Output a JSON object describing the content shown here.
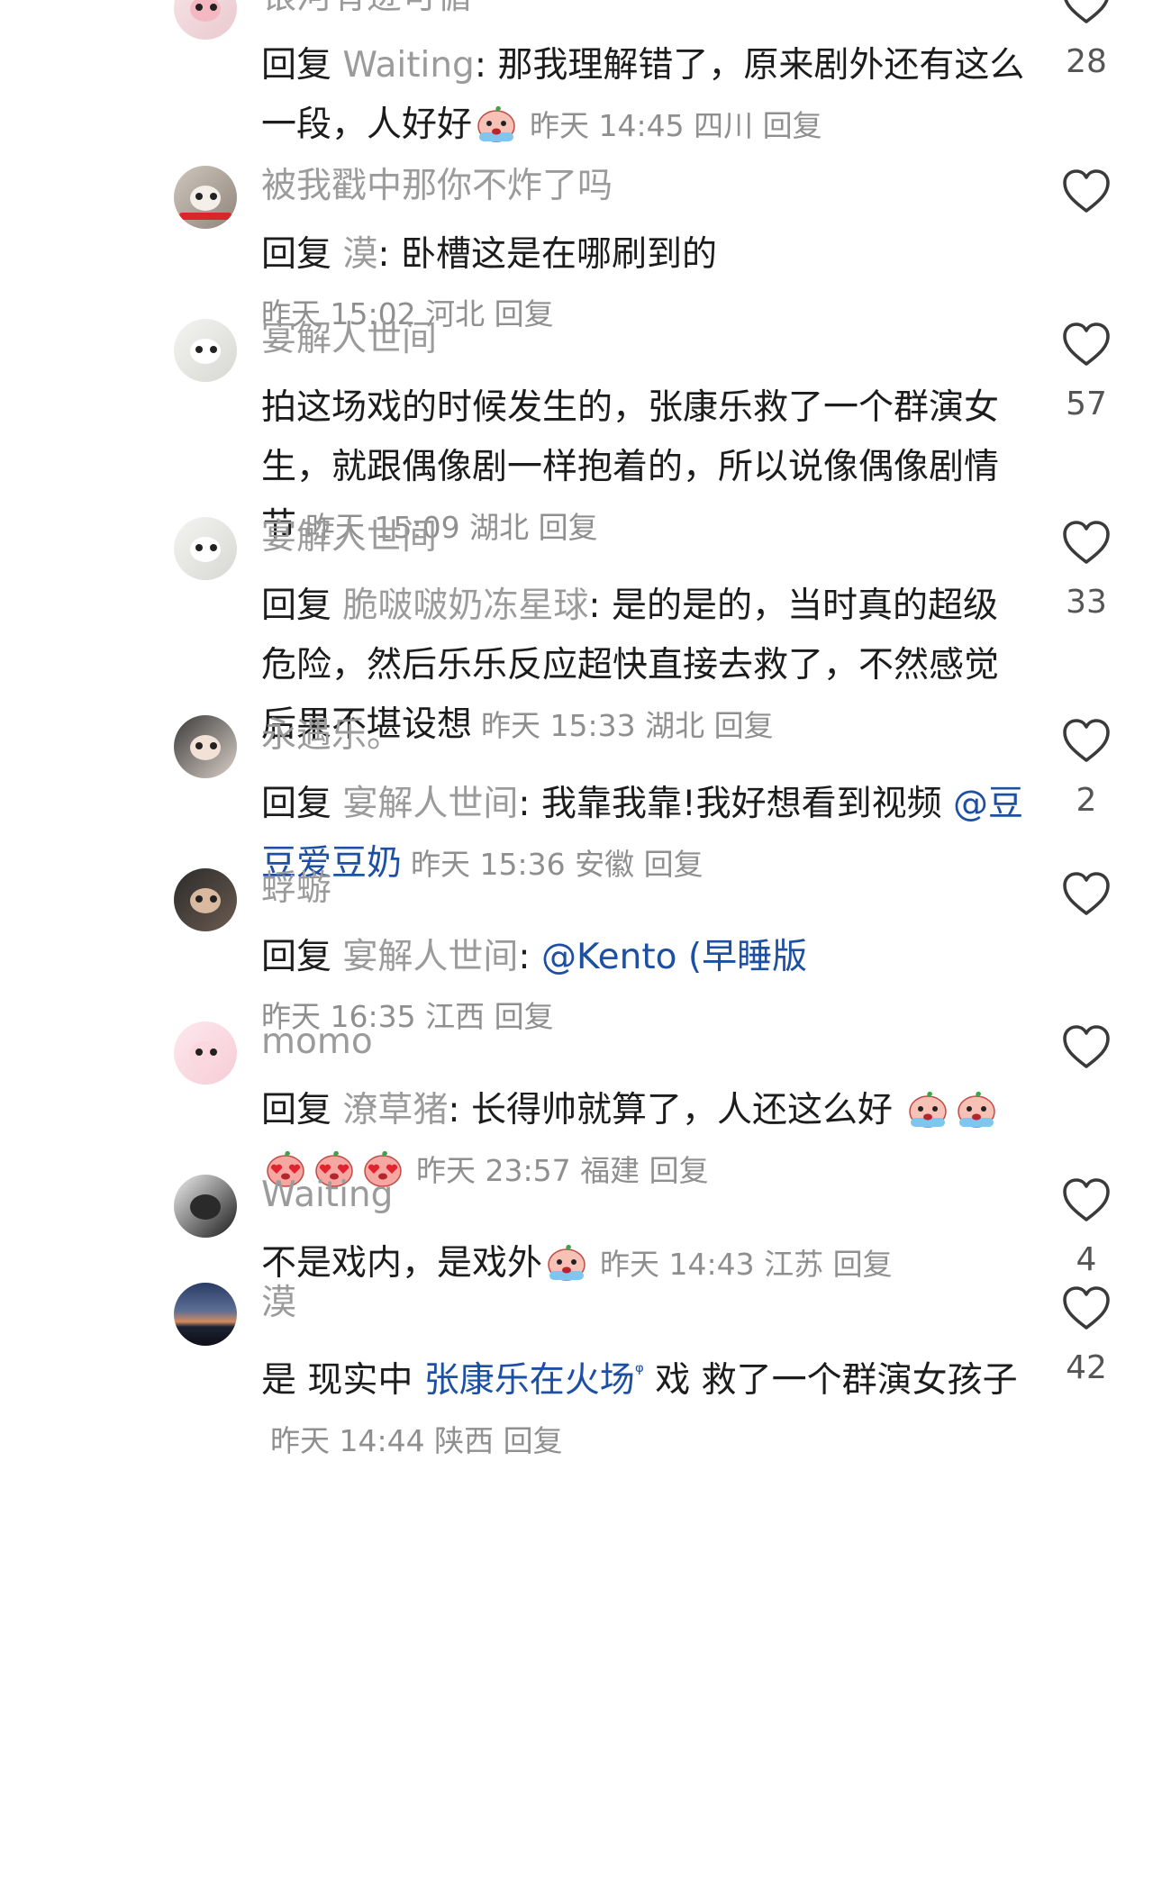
{
  "colors": {
    "text": "#1c1c1c",
    "username": "#9b9b9b",
    "meta": "#8f8f8f",
    "mention": "#1d4fa3",
    "like_outline": "#3a3a3a"
  },
  "comments": [
    {
      "username": "银河有迹可循",
      "avatar": "pink-cartoon-avatar",
      "reply_prefix": "回复 ",
      "reply_to": "Waiting",
      "text_segments": [
        {
          "type": "text",
          "text": ": 那我理解错了，原来剧外还有这么一段，人好好"
        },
        {
          "type": "emoji",
          "icon": "crying-peach-emoji"
        }
      ],
      "time": "昨天 14:45",
      "location": "四川",
      "reply_label": "回复",
      "likes": "28"
    },
    {
      "username": "被我戳中那你不炸了吗",
      "avatar": "cat-avatar",
      "reply_prefix": "回复 ",
      "reply_to": "漠",
      "text_segments": [
        {
          "type": "text",
          "text": ": 卧槽这是在哪刷到的"
        }
      ],
      "time": "昨天 15:02",
      "location": "河北",
      "reply_label": "回复",
      "likes": ""
    },
    {
      "username": "宴解人世间",
      "avatar": "white-dog-glasses-avatar",
      "reply_prefix": "",
      "reply_to": "",
      "text_segments": [
        {
          "type": "text",
          "text": "拍这场戏的时候发生的，张康乐救了一个群演女生，就跟偶像剧一样抱着的，所以说像偶像剧情节"
        }
      ],
      "time": "昨天 15:09",
      "location": "湖北",
      "reply_label": "回复",
      "likes": "57"
    },
    {
      "username": "宴解人世间",
      "avatar": "white-dog-glasses-avatar",
      "reply_prefix": "回复 ",
      "reply_to": "脆啵啵奶冻星球",
      "text_segments": [
        {
          "type": "text",
          "text": ": 是的是的，当时真的超级危险，然后乐乐反应超快直接去救了，不然感觉后果不堪设想"
        }
      ],
      "time": "昨天 15:33",
      "location": "湖北",
      "reply_label": "回复",
      "likes": "33"
    },
    {
      "username": "永遇乐。",
      "avatar": "girl-portrait-avatar",
      "reply_prefix": "回复 ",
      "reply_to": "宴解人世间",
      "text_segments": [
        {
          "type": "text",
          "text": ": 我靠我靠!我好想看到视频 "
        },
        {
          "type": "mention",
          "text": "@豆豆爱豆奶"
        }
      ],
      "time": "昨天 15:36",
      "location": "安徽",
      "reply_label": "回复",
      "likes": "2"
    },
    {
      "username": "蜉蝣",
      "avatar": "boy-portrait-avatar",
      "reply_prefix": "回复 ",
      "reply_to": "宴解人世间",
      "text_segments": [
        {
          "type": "text",
          "text": ": "
        },
        {
          "type": "mention",
          "text": "@Kento (早睡版"
        }
      ],
      "time": "昨天 16:35",
      "location": "江西",
      "reply_label": "回复",
      "likes": ""
    },
    {
      "username": "momo",
      "avatar": "pink-blob-avatar",
      "reply_prefix": "回复 ",
      "reply_to": "潦草猪",
      "text_segments": [
        {
          "type": "text",
          "text": ": 长得帅就算了，人还这么好 "
        },
        {
          "type": "emoji",
          "icon": "crying-peach-emoji"
        },
        {
          "type": "emoji",
          "icon": "crying-peach-emoji"
        },
        {
          "type": "emoji",
          "icon": "heart-eyes-peach-emoji"
        },
        {
          "type": "emoji",
          "icon": "heart-eyes-peach-emoji"
        },
        {
          "type": "emoji",
          "icon": "heart-eyes-peach-emoji"
        }
      ],
      "time": "昨天 23:57",
      "location": "福建",
      "reply_label": "回复",
      "likes": ""
    },
    {
      "username": "Waiting",
      "avatar": "dark-silhouette-avatar",
      "reply_prefix": "",
      "reply_to": "",
      "text_segments": [
        {
          "type": "text",
          "text": "不是戏内，是戏外"
        },
        {
          "type": "emoji",
          "icon": "crying-peach-emoji"
        }
      ],
      "time": "昨天 14:43",
      "location": "江苏",
      "reply_label": "回复",
      "likes": "4"
    },
    {
      "username": "漠",
      "avatar": "sunset-landscape-avatar",
      "reply_prefix": "",
      "reply_to": "",
      "text_segments": [
        {
          "type": "text",
          "text": "是 现实中 "
        },
        {
          "type": "mention",
          "text": "张康乐在火场"
        },
        {
          "type": "search",
          "text": "ᵠ"
        },
        {
          "type": "text",
          "text": " 戏  救了一个群演女孩子"
        }
      ],
      "time": "昨天 14:44",
      "location": "陕西",
      "reply_label": "回复",
      "likes": "42"
    }
  ]
}
